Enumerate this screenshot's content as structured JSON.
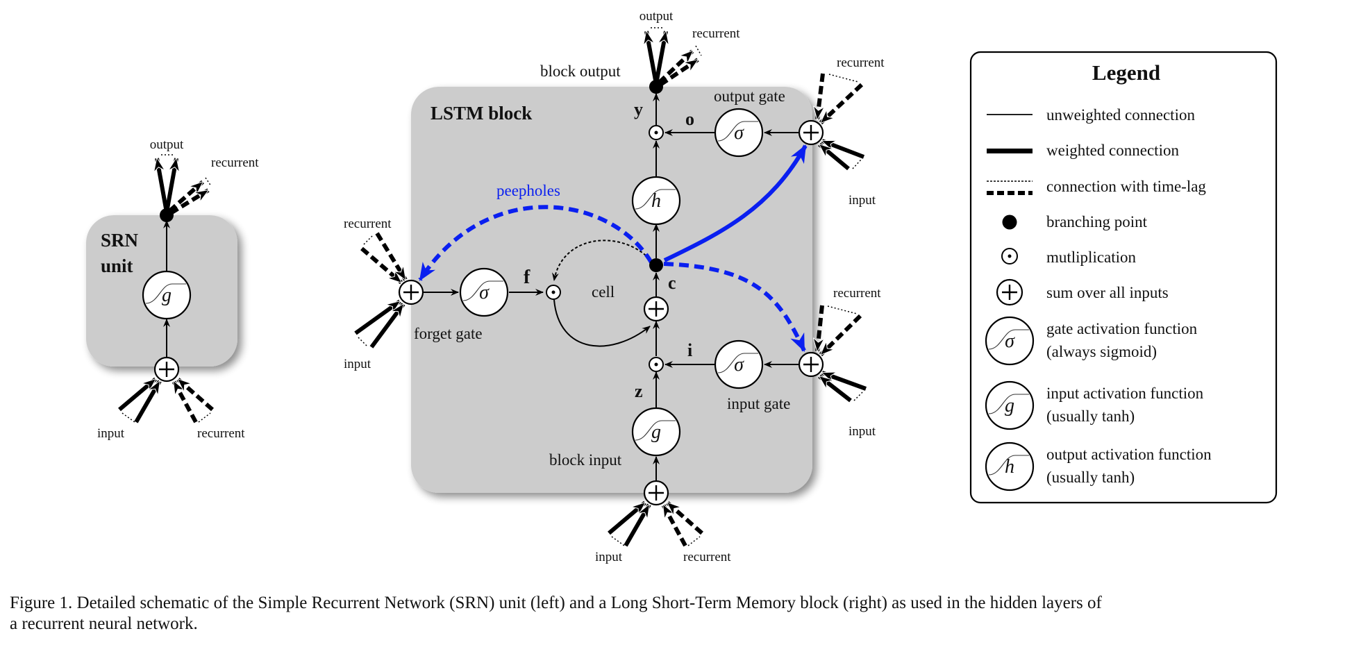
{
  "srn": {
    "title_line1": "SRN",
    "title_line2": "unit",
    "node_activation": "g",
    "labels": {
      "output": "output",
      "recurrent_out": "recurrent",
      "input": "input",
      "recurrent_in": "recurrent"
    }
  },
  "lstm": {
    "title": "LSTM block",
    "block_output": "block output",
    "output": "output",
    "recurrent_out": "recurrent",
    "peepholes": "peepholes",
    "cell": "cell",
    "forget_gate": "forget gate",
    "input_gate": "input gate",
    "output_gate": "output gate",
    "block_input": "block input",
    "vars": {
      "y": "y",
      "o": "o",
      "f": "f",
      "c": "c",
      "i": "i",
      "z": "z"
    },
    "activations": {
      "gate": "σ",
      "input": "g",
      "output": "h"
    },
    "external": {
      "forget_recurrent": "recurrent",
      "forget_input": "input",
      "output_recurrent": "recurrent",
      "output_input": "input",
      "inputgate_recurrent": "recurrent",
      "inputgate_input": "input",
      "block_input": "input",
      "block_recurrent": "recurrent"
    }
  },
  "legend": {
    "title": "Legend",
    "items": [
      {
        "symbol": "thin-line",
        "label": "unweighted connection"
      },
      {
        "symbol": "thick-line",
        "label": "weighted connection"
      },
      {
        "symbol": "dashed-line",
        "label": "connection with time-lag"
      },
      {
        "symbol": "filled-dot",
        "label": "branching point"
      },
      {
        "symbol": "odot",
        "label": "mutliplication"
      },
      {
        "symbol": "oplus",
        "label": "sum over all inputs"
      },
      {
        "symbol": "sigma-circle",
        "glyph": "σ",
        "label": "gate activation function",
        "label2": "(always sigmoid)"
      },
      {
        "symbol": "g-circle",
        "glyph": "g",
        "label": "input activation function",
        "label2": "(usually tanh)"
      },
      {
        "symbol": "h-circle",
        "glyph": "h",
        "label": "output activation function",
        "label2": "(usually tanh)"
      }
    ]
  },
  "colors": {
    "block_fill": "#cccccc",
    "peephole": "#0a1ff0",
    "ink": "#000000"
  },
  "caption": {
    "line1": "Figure 1.  Detailed schematic of the Simple Recurrent Network (SRN) unit (left) and a Long Short-Term Memory block (right) as used in the hidden layers of",
    "line2": "a recurrent neural network."
  }
}
